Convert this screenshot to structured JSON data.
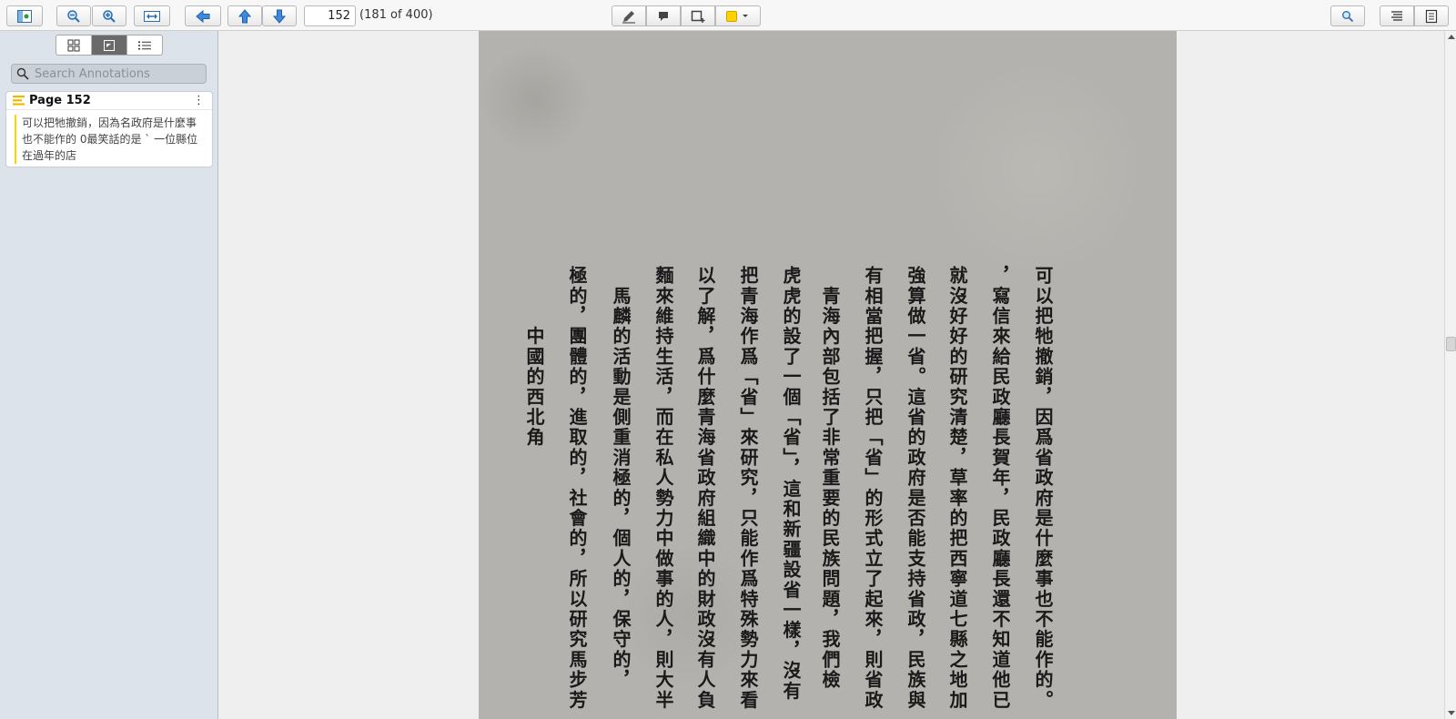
{
  "toolbar": {
    "page_input_value": "152",
    "page_count": "(181 of 400)",
    "highlight_color": "#ffd200"
  },
  "sidebar": {
    "search_placeholder": "Search Annotations",
    "annotation": {
      "title": "Page 152",
      "menu_glyph": "⋮",
      "text": "可以把牠撤銷，因為名政府是什麼事也不能作的 0最笑話的是 ` 一位縣位在過年的店"
    }
  },
  "document": {
    "columns": [
      "可以把牠撤銷，因爲省政府是什麼事也不能作的。",
      "，寫信來給民政廳長賀年，民政廳長還不知道他已",
      "就沒好好的研究清楚，草率的把西寧道七縣之地加",
      "強算做一省。這省的政府是否能支持省政，民族與",
      "有相當把握，只把「省」的形式立了起來，則省政",
      "　青海內部包括了非常重要的民族問題，我們檢",
      "虎虎的設了一個「省」，這和新疆設省一樣，沒有",
      "把青海作爲「省」來研究，只能作爲特殊勢力來看",
      "以了解，爲什麼青海省政府組織中的財政沒有人負",
      "麵來維持生活，而在私人勢力中做事的人，則大半",
      "　馬麟的活動是側重消極的，個人的，保守的，",
      "極的，團體的，進取的，社會的，所以研究馬步芳",
      "　　　中國的西北角"
    ]
  }
}
